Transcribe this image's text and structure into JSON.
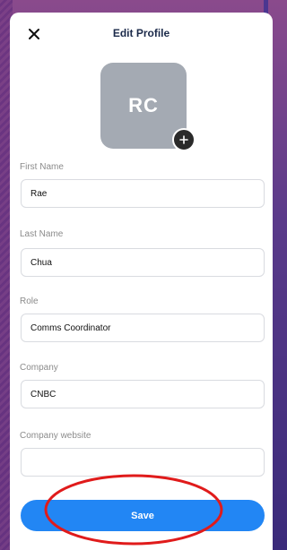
{
  "header": {
    "title": "Edit Profile"
  },
  "avatar": {
    "initials": "RC",
    "color": "#a4aab3"
  },
  "fields": [
    {
      "label": "First Name",
      "value": "Rae",
      "placeholder": ""
    },
    {
      "label": "Last Name",
      "value": "Chua",
      "placeholder": ""
    },
    {
      "label": "Role",
      "value": "Comms Coordinator",
      "placeholder": ""
    },
    {
      "label": "Company",
      "value": "CNBC",
      "placeholder": ""
    },
    {
      "label": "Company website",
      "value": "",
      "placeholder": ""
    }
  ],
  "save": {
    "label": "Save",
    "color": "#2286f4"
  },
  "icons": {
    "close": "close-icon",
    "add": "plus-icon"
  },
  "annotation": {
    "color": "#e01b1b"
  }
}
